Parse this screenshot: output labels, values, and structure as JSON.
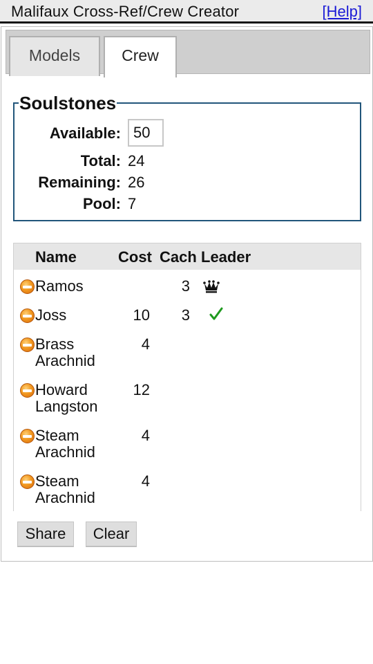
{
  "header": {
    "title": "Malifaux Cross-Ref/Crew Creator",
    "help_link": "[Help]"
  },
  "tabs": [
    {
      "label": "Models",
      "active": false
    },
    {
      "label": "Crew",
      "active": true
    }
  ],
  "soulstones": {
    "legend": "Soulstones",
    "available_label": "Available:",
    "available_value": "50",
    "total_label": "Total:",
    "total_value": "24",
    "remaining_label": "Remaining:",
    "remaining_value": "26",
    "pool_label": "Pool:",
    "pool_value": "7"
  },
  "crew_table": {
    "columns": [
      "Name",
      "Cost",
      "Cach",
      "Leader"
    ],
    "rows": [
      {
        "name_lines": [
          "Ramos"
        ],
        "cost": "",
        "cach": "3",
        "leader": "crown-icon"
      },
      {
        "name_lines": [
          "Joss"
        ],
        "cost": "10",
        "cach": "3",
        "leader": "check-icon"
      },
      {
        "name_lines": [
          "Brass",
          "Arachnid"
        ],
        "cost": "4",
        "cach": "",
        "leader": ""
      },
      {
        "name_lines": [
          "Howard",
          "Langston"
        ],
        "cost": "12",
        "cach": "",
        "leader": ""
      },
      {
        "name_lines": [
          "Steam",
          "Arachnid"
        ],
        "cost": "4",
        "cach": "",
        "leader": ""
      },
      {
        "name_lines": [
          "Steam",
          "Arachnid"
        ],
        "cost": "4",
        "cach": "",
        "leader": ""
      }
    ]
  },
  "buttons": {
    "share": "Share",
    "clear": "Clear"
  },
  "colors": {
    "fieldset_border": "#21557a",
    "link": "#1a1ad6",
    "check": "#1f9a1f",
    "remove": "#f29a22"
  }
}
